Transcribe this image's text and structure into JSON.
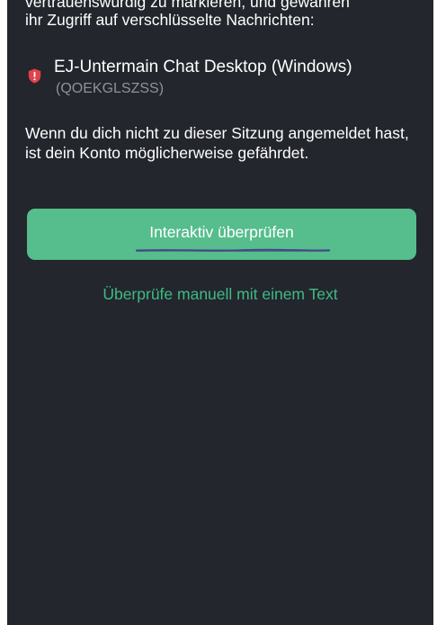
{
  "intro": {
    "cut_off_line": "vertrauenswürdig zu markieren, und gewähren",
    "line": "ihr Zugriff auf verschlüsselte Nachrichten:"
  },
  "session": {
    "icon": "shield-warning-icon",
    "name": "EJ-Untermain Chat Desktop (Windows)",
    "device_id": "(QOEKGLSZSS)"
  },
  "warning_text": "Wenn du dich nicht zu dieser Sitzung angemeldet hast, ist dein Konto möglicherweise gefährdet.",
  "actions": {
    "primary_label": "Interaktiv überprüfen",
    "secondary_label": "Überprüfe manuell mit einem Text"
  },
  "colors": {
    "background": "#23262c",
    "primary_button": "#56bd8c",
    "link": "#3fba85",
    "muted_text": "#8e929b",
    "shield": "#e0424b"
  }
}
